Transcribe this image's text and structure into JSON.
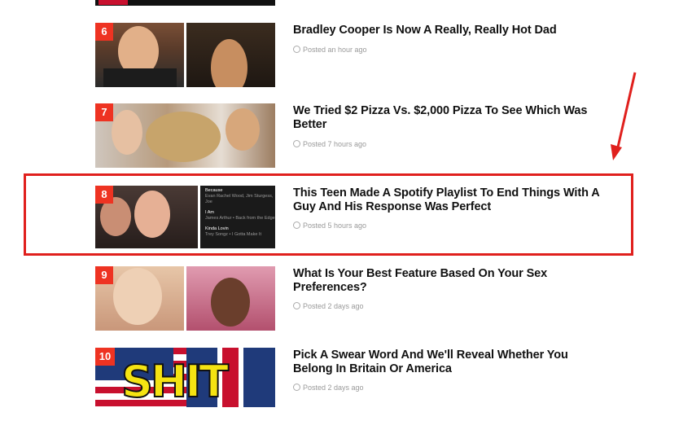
{
  "articles": [
    {
      "rank": "6",
      "title": "Bradley Cooper Is Now A Really, Really Hot Dad",
      "meta": "Posted an hour ago"
    },
    {
      "rank": "7",
      "title": "We Tried $2 Pizza Vs. $2,000 Pizza To See Which Was Better",
      "meta": "Posted 7 hours ago"
    },
    {
      "rank": "8",
      "title": "This Teen Made A Spotify Playlist To End Things With A Guy And His Response Was Perfect",
      "meta": "Posted 5 hours ago",
      "playlist": [
        {
          "song": "Because",
          "artist": "Evan Rachel Wood, Jim Sturgess, Joe"
        },
        {
          "song": "I Am",
          "artist": "James Arthur • Back from the Edge"
        },
        {
          "song": "Kinda Lovin",
          "artist": "Trey Songz • I Gotta Make It"
        }
      ]
    },
    {
      "rank": "9",
      "title": "What Is Your Best Feature Based On Your Sex Preferences?",
      "meta": "Posted 2 days ago"
    },
    {
      "rank": "10",
      "title": "Pick A Swear Word And We'll Reveal Whether You Belong In Britain Or America",
      "meta": "Posted 2 days ago",
      "thumb_text": "SHIT"
    }
  ],
  "colors": {
    "highlight": "#e0201d",
    "rank_badge": "#ee3322",
    "arrow": "#e0201d"
  }
}
